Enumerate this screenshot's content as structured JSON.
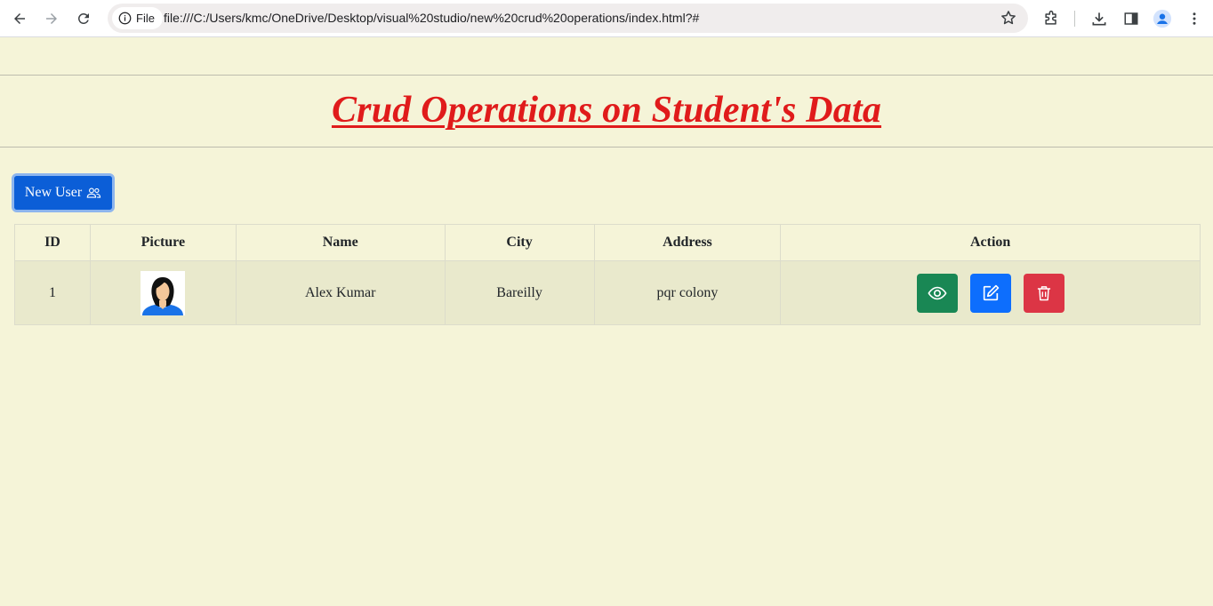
{
  "browser": {
    "chip_label": "File",
    "url": "file:///C:/Users/kmc/OneDrive/Desktop/visual%20studio/new%20crud%20operations/index.html?#"
  },
  "page": {
    "title": "Crud Operations on Student's Data",
    "new_user_label": "New User"
  },
  "table": {
    "headers": [
      "ID",
      "Picture",
      "Name",
      "City",
      "Address",
      "Action"
    ],
    "rows": [
      {
        "id": "1",
        "name": "Alex Kumar",
        "city": "Bareilly",
        "address": "pqr colony"
      }
    ]
  },
  "colors": {
    "title": "#e01b1b",
    "primary": "#0d6efd",
    "view": "#198754",
    "delete": "#dc3545",
    "background": "#f5f4d8"
  }
}
